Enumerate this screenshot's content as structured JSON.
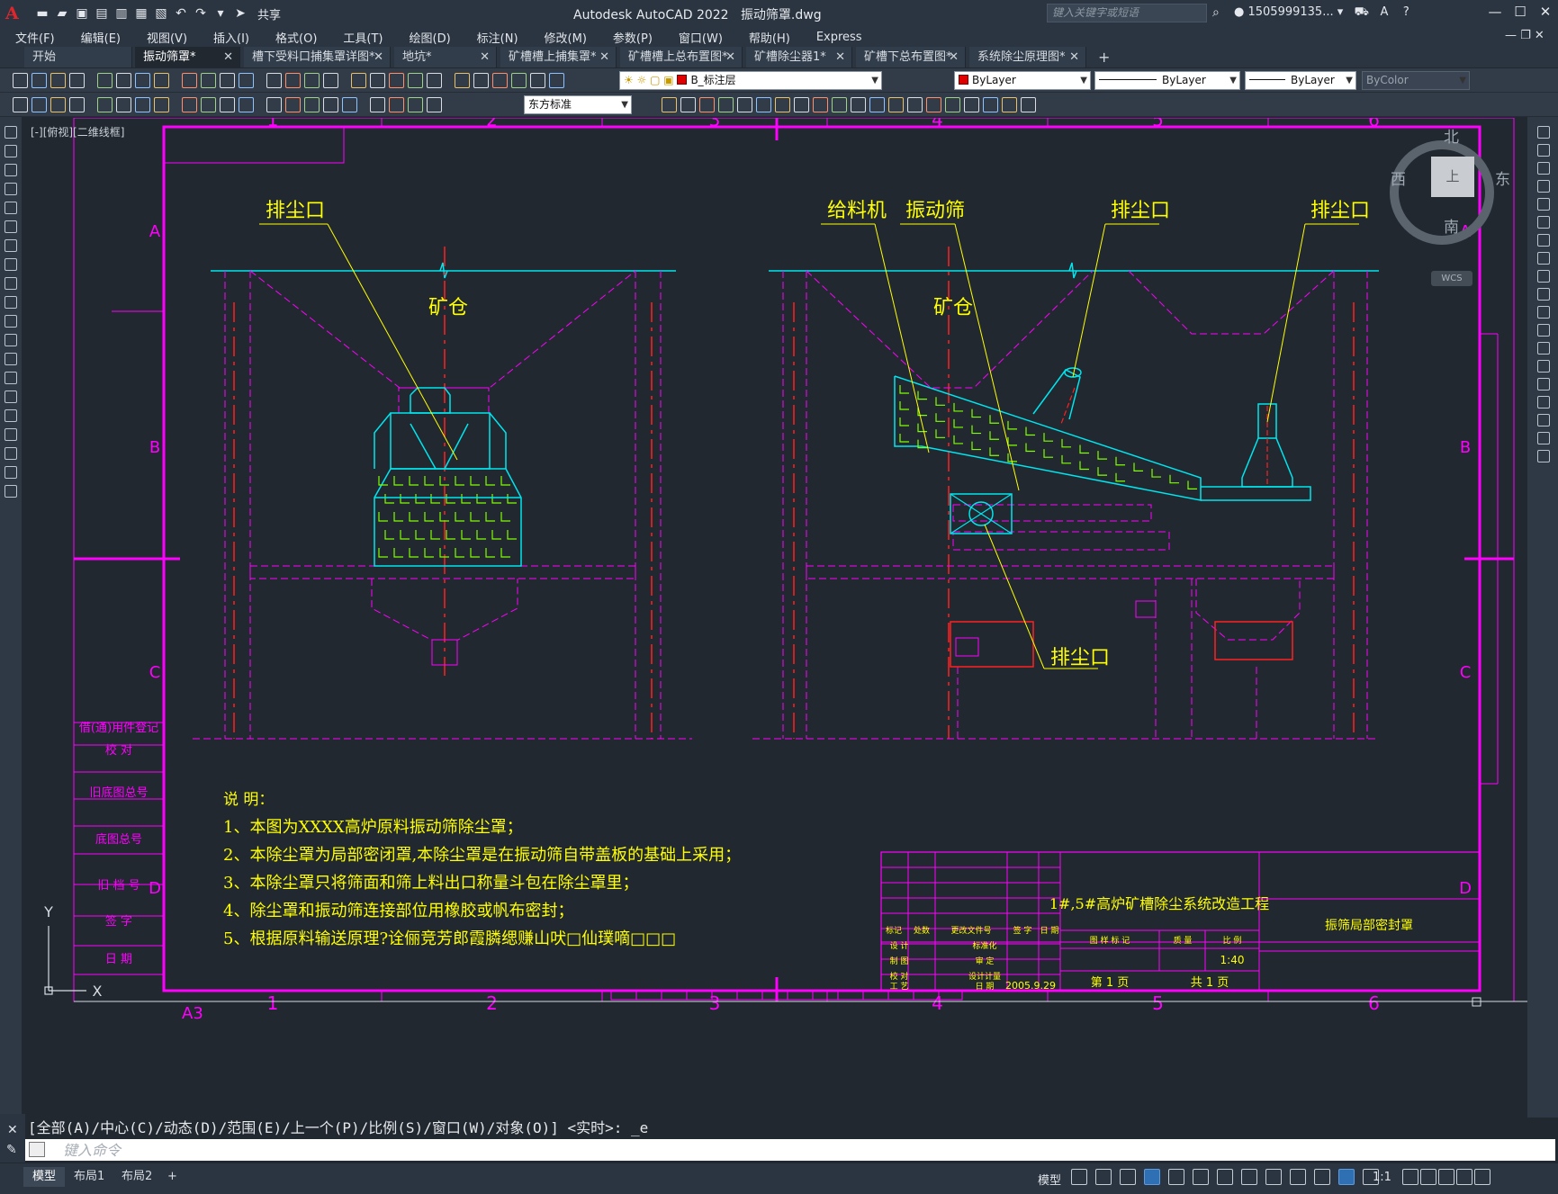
{
  "app": {
    "logo": "A",
    "title": "Autodesk AutoCAD 2022",
    "file_name": "振动筛罩.dwg",
    "share_label": "共享",
    "search_placeholder": "键入关键字或短语",
    "user": "1505999135...",
    "user_menu": "▾"
  },
  "menu": [
    "文件(F)",
    "编辑(E)",
    "视图(V)",
    "插入(I)",
    "格式(O)",
    "工具(T)",
    "绘图(D)",
    "标注(N)",
    "修改(M)",
    "参数(P)",
    "窗口(W)",
    "帮助(H)",
    "Express"
  ],
  "tabs": [
    {
      "label": "开始",
      "active": false
    },
    {
      "label": "振动筛罩*",
      "active": true
    },
    {
      "label": "槽下受料口捕集罩详图*",
      "active": false
    },
    {
      "label": "地坑*",
      "active": false
    },
    {
      "label": "矿槽槽上捕集罩*",
      "active": false
    },
    {
      "label": "矿槽槽上总布置图*",
      "active": false
    },
    {
      "label": "矿槽除尘器1*",
      "active": false
    },
    {
      "label": "矿槽下总布置图*",
      "active": false
    },
    {
      "label": "系统除尘原理图*",
      "active": false
    }
  ],
  "toolbar": {
    "layer": "B_标注层",
    "color": "ByLayer",
    "linetype": "ByLayer",
    "lineweight": "ByLayer",
    "plotstyle": "ByColor",
    "text_style": "东方标准"
  },
  "viewport": {
    "label": "[-][俯视][二维线框]",
    "viewcube": {
      "north": "北",
      "south": "南",
      "west": "西",
      "east": "东",
      "face": "上",
      "wcs": "WCS"
    }
  },
  "drawing": {
    "col_labels": [
      "1",
      "2",
      "3",
      "4",
      "5",
      "6"
    ],
    "row_labels": [
      "A",
      "B",
      "C",
      "D"
    ],
    "sheet_size": "A3",
    "label_dust_outlet": "排尘口",
    "label_bin": "矿仓",
    "label_feeder": "给料机",
    "label_screen": "振动筛",
    "notes_title": "说 明：",
    "notes": [
      "1、本图为XXXX高炉原料振动筛除尘罩；",
      "2、本除尘罩为局部密闭罩,本除尘罩是在振动筛自带盖板的基础上采用；",
      "3、本除尘罩只将筛面和筛上料出口称量斗包在除尘罩里；",
      "4、除尘罩和振动筛连接部位用橡胶或帆布密封；",
      "5、根据原料输送原理?诠俪竞芳郎霞膦缌赚山吠□仙璞嘀□□□"
    ],
    "side_table": [
      "借(通)用件登记",
      "校 对",
      "旧底图总号",
      "底图总号",
      "旧 档 号",
      "签 字",
      "日 期"
    ],
    "title_block": {
      "project": "1#,5#高炉矿槽除尘系统改造工程",
      "drawing_name": "振筛局部密封罩",
      "scale": "1:40",
      "date": "2005.9.29",
      "sheet": "第 1 页",
      "total": "共 1 页",
      "col_mark": "标记",
      "col_count": "处数",
      "col_doc": "更改文件号",
      "col_sign": "签 字",
      "col_date": "日 期",
      "row_design": "设 计",
      "row_draw": "制 图",
      "row_check": "校 对",
      "row_process": "工 艺",
      "std": "标准化",
      "review": "审 定",
      "plan": "设计计量",
      "date_label": "日 期",
      "stage": "图 样 标 记",
      "weight": "质 量",
      "ratio": "比 例"
    }
  },
  "command": {
    "history": "[全部(A)/中心(C)/动态(D)/范围(E)/上一个(P)/比例(S)/窗口(W)/对象(O)] <实时>: _e",
    "placeholder": "键入命令"
  },
  "status": {
    "layouts": [
      "模型",
      "布局1",
      "布局2"
    ],
    "model_label": "模型",
    "scale": "1:1"
  },
  "colors": {
    "magenta": "#ff00ff",
    "yellow": "#ffff00",
    "cyan": "#00e5ee",
    "red": "#ff2020",
    "green": "#7fff00",
    "frame": "#ff00ff"
  }
}
